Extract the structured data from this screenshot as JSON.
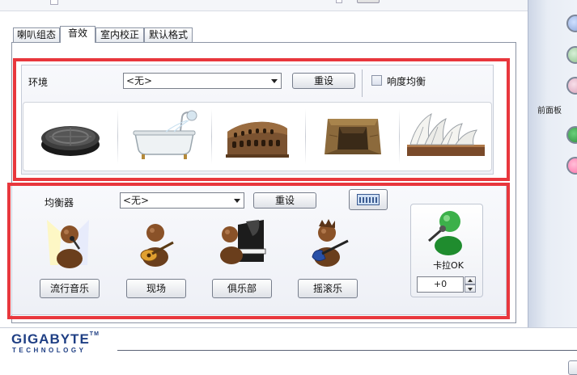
{
  "tabs": [
    {
      "label": "喇叭组态"
    },
    {
      "label": "音效"
    },
    {
      "label": "室内校正"
    },
    {
      "label": "默认格式"
    }
  ],
  "environment": {
    "label": "环境",
    "select_value": "<无>",
    "reset_label": "重设",
    "loudness_label": "响度均衡",
    "loudness_checked": false,
    "presets": [
      "manhole-icon",
      "bathtub-icon",
      "colosseum-icon",
      "stone-corridor-icon",
      "opera-house-icon"
    ]
  },
  "equalizer": {
    "label": "均衡器",
    "select_value": "<无>",
    "reset_label": "重设",
    "presets": [
      {
        "label": "流行音乐",
        "icon": "singer-icon"
      },
      {
        "label": "现场",
        "icon": "guitarist-icon"
      },
      {
        "label": "俱乐部",
        "icon": "pianist-icon"
      },
      {
        "label": "摇滚乐",
        "icon": "rock-guitarist-icon"
      }
    ]
  },
  "karaoke": {
    "label": "卡拉OK",
    "value": "+0"
  },
  "side_panel": {
    "front_panel_label": "前面板",
    "jack_colors": [
      "#2c8c3c",
      "#ff6fa8"
    ]
  },
  "brand": {
    "name": "GIGABYTE",
    "tm": "TM",
    "sub": "TECHNOLOGY",
    "color": "#1f3f84"
  },
  "colors": {
    "highlight": "#e8373d"
  }
}
